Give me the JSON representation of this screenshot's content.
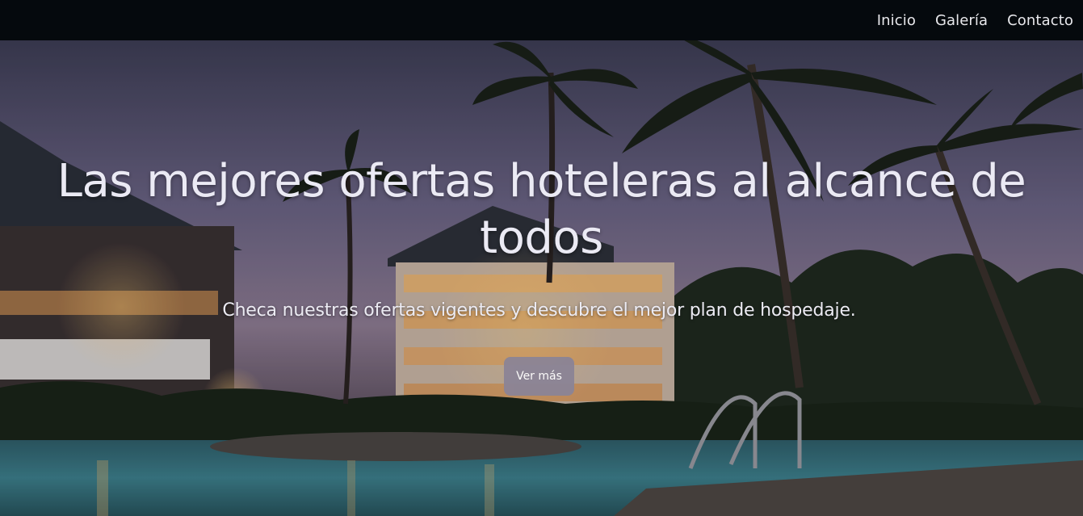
{
  "nav": {
    "items": [
      {
        "label": "Inicio"
      },
      {
        "label": "Galería"
      },
      {
        "label": "Contacto"
      }
    ]
  },
  "hero": {
    "title": "Las mejores ofertas hoteleras al alcance de todos",
    "subtitle": "Checa nuestras ofertas vigentes y descubre el mejor plan de hospedaje.",
    "button_label": "Ver más",
    "background_description_icon": "hotel-pool-night-photo"
  },
  "colors": {
    "navbar_bg": "#05090d",
    "button_bg": "#8b8496",
    "text": "#ebeaf4"
  }
}
